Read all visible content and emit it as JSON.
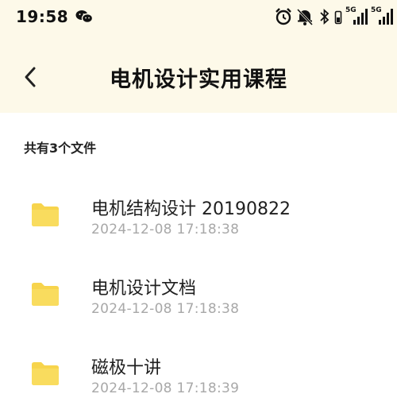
{
  "status_bar": {
    "time": "19:58",
    "network_1": "5G",
    "network_2": "5G"
  },
  "header": {
    "title": "电机设计实用课程"
  },
  "summary": {
    "file_count_text": "共有3个文件"
  },
  "files": [
    {
      "name": "电机结构设计 20190822",
      "time": "2024-12-08  17:18:38",
      "icon": "folder-icon"
    },
    {
      "name": "电机设计文档",
      "time": "2024-12-08  17:18:38",
      "icon": "folder-icon"
    },
    {
      "name": "磁极十讲",
      "time": "2024-12-08  17:18:39",
      "icon": "folder-icon"
    }
  ],
  "colors": {
    "header_bg": "#fdf9e9",
    "folder": "#f7d44c",
    "timestamp": "#a8a8a8"
  }
}
